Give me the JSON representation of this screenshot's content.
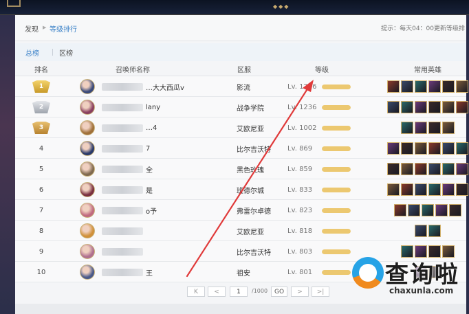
{
  "breadcrumb": {
    "home": "发现",
    "current": "等级排行"
  },
  "tip": "提示：每天04：00更新等级排",
  "tabs": [
    {
      "label": "总榜"
    },
    {
      "label": "区榜"
    }
  ],
  "table_headers": {
    "rank": "排名",
    "name": "召唤师名称",
    "region": "区服",
    "level": "等级",
    "heroes": "常用英雄"
  },
  "rows": [
    {
      "rank": "1",
      "name": "…大大西瓜v",
      "region": "影流",
      "level": "Lv. 1296",
      "level_fill": 1.0,
      "hero_count": 6,
      "avatar": "#3a4a7a"
    },
    {
      "rank": "2",
      "name": "lany",
      "region": "战争学院",
      "level": "Lv. 1236",
      "level_fill": 1.0,
      "hero_count": 6,
      "avatar": "#8a4060"
    },
    {
      "rank": "3",
      "name": "…4",
      "region": "艾欧尼亚",
      "level": "Lv. 1002",
      "level_fill": 1.0,
      "hero_count": 4,
      "avatar": "#a0703a"
    },
    {
      "rank": "4",
      "name": "7",
      "region": "比尔吉沃特",
      "level": "Lv. 869",
      "level_fill": 1.0,
      "hero_count": 6,
      "avatar": "#2a3a6a"
    },
    {
      "rank": "5",
      "name": "全",
      "region": "黑色玫瑰",
      "level": "Lv. 859",
      "level_fill": 1.0,
      "hero_count": 6,
      "avatar": "#806a50"
    },
    {
      "rank": "6",
      "name": "是",
      "region": "班德尔城",
      "level": "Lv. 833",
      "level_fill": 1.0,
      "hero_count": 6,
      "avatar": "#7a3040"
    },
    {
      "rank": "7",
      "name": "o予",
      "region": "弗雷尔卓德",
      "level": "Lv. 823",
      "level_fill": 1.0,
      "hero_count": 5,
      "avatar": "#c06a80"
    },
    {
      "rank": "8",
      "name": "",
      "region": "艾欧尼亚",
      "level": "Lv. 818",
      "level_fill": 1.0,
      "hero_count": 2,
      "avatar": "#d0903a"
    },
    {
      "rank": "9",
      "name": "",
      "region": "比尔吉沃特",
      "level": "Lv. 803",
      "level_fill": 1.0,
      "hero_count": 4,
      "avatar": "#b07090"
    },
    {
      "rank": "10",
      "name": "王",
      "region": "祖安",
      "level": "Lv. 801",
      "level_fill": 1.0,
      "hero_count": 2,
      "avatar": "#4a5a8a"
    }
  ],
  "hero_colors": [
    "#8a3a2a",
    "#3a4a6a",
    "#2a6a6a",
    "#6a3a7a",
    "#3a2a2a",
    "#7a5a3a"
  ],
  "pagination": {
    "first": "K",
    "prev": "<",
    "page": "1",
    "total": "/1000",
    "go": "GO",
    "next": ">",
    "last": ">|"
  },
  "watermark": {
    "text": "查询啦",
    "domain": "chaxunla.com"
  },
  "colors": {
    "accent": "#3c82c8",
    "level_bar": "#ecc870",
    "arrow": "#e03a3a"
  }
}
